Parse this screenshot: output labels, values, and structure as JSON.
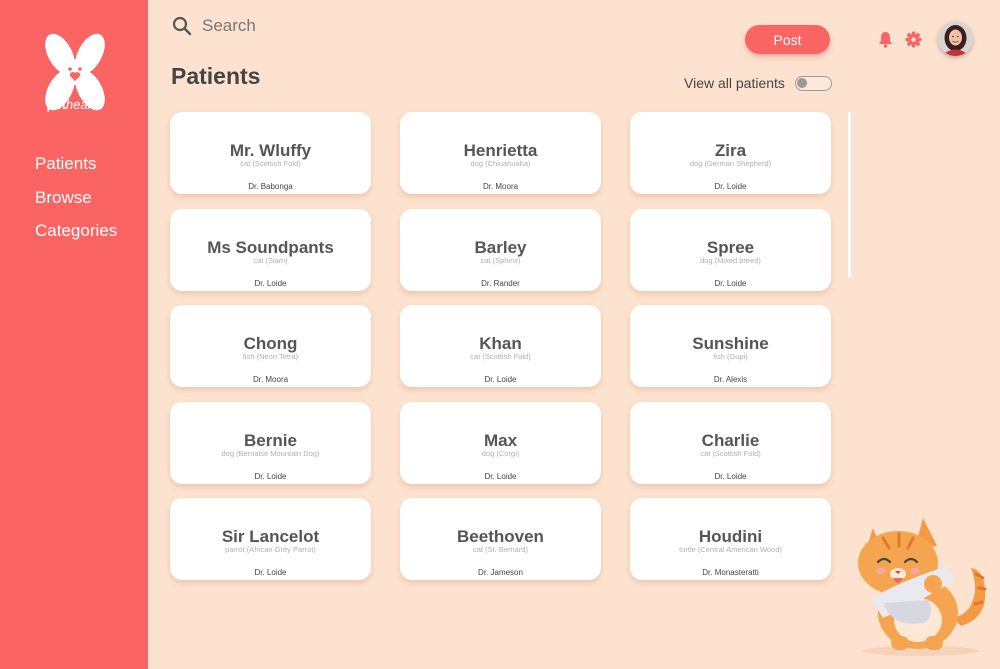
{
  "brand": {
    "logo_prefix": "pet",
    "logo_suffix": "health"
  },
  "sidebar": {
    "items": [
      {
        "label": "Patients"
      },
      {
        "label": "Browse"
      },
      {
        "label": "Categories"
      }
    ]
  },
  "header": {
    "search_placeholder": "Search",
    "post_label": "Post",
    "icons": [
      "search-icon",
      "bell-icon",
      "gear-icon"
    ]
  },
  "main": {
    "title": "Patients",
    "view_all_label": "View all patients",
    "view_all_on": false
  },
  "patients": [
    {
      "name": "Mr. Wluffy",
      "species": "cat (Scottish Fold)",
      "doctor": "Dr. Babonga"
    },
    {
      "name": "Henrietta",
      "species": "dog (Chiuahuaha)",
      "doctor": "Dr. Moora"
    },
    {
      "name": "Zira",
      "species": "dog (German Shepherd)",
      "doctor": "Dr. Loide"
    },
    {
      "name": "Ms Soundpants",
      "species": "cat (Siam)",
      "doctor": "Dr. Loide"
    },
    {
      "name": "Barley",
      "species": "cat (Sphinx)",
      "doctor": "Dr. Rander"
    },
    {
      "name": "Spree",
      "species": "dog (Mixed breed)",
      "doctor": "Dr. Loide"
    },
    {
      "name": "Chong",
      "species": "fish (Neon Tetra)",
      "doctor": "Dr. Moora"
    },
    {
      "name": "Khan",
      "species": "cat (Scottish Fold)",
      "doctor": "Dr. Loide"
    },
    {
      "name": "Sunshine",
      "species": "fish (Gupi)",
      "doctor": "Dr. Alexis"
    },
    {
      "name": "Bernie",
      "species": "dog (Bernaise Mountain Dog)",
      "doctor": "Dr. Loide"
    },
    {
      "name": "Max",
      "species": "dog (Corgi)",
      "doctor": "Dr. Loide"
    },
    {
      "name": "Charlie",
      "species": "cat (Scottish Fold)",
      "doctor": "Dr. Loide"
    },
    {
      "name": "Sir Lancelot",
      "species": "parrot (African Grey Parrot)",
      "doctor": "Dr. Loide"
    },
    {
      "name": "Beethoven",
      "species": "cat (St. Bernard)",
      "doctor": "Dr. Jameson"
    },
    {
      "name": "Houdini",
      "species": "turtle (Central American Wood)",
      "doctor": "Dr. Monasteratti"
    }
  ],
  "colors": {
    "accent": "#fa6463",
    "background": "#fde3cf",
    "card": "#ffffff"
  }
}
